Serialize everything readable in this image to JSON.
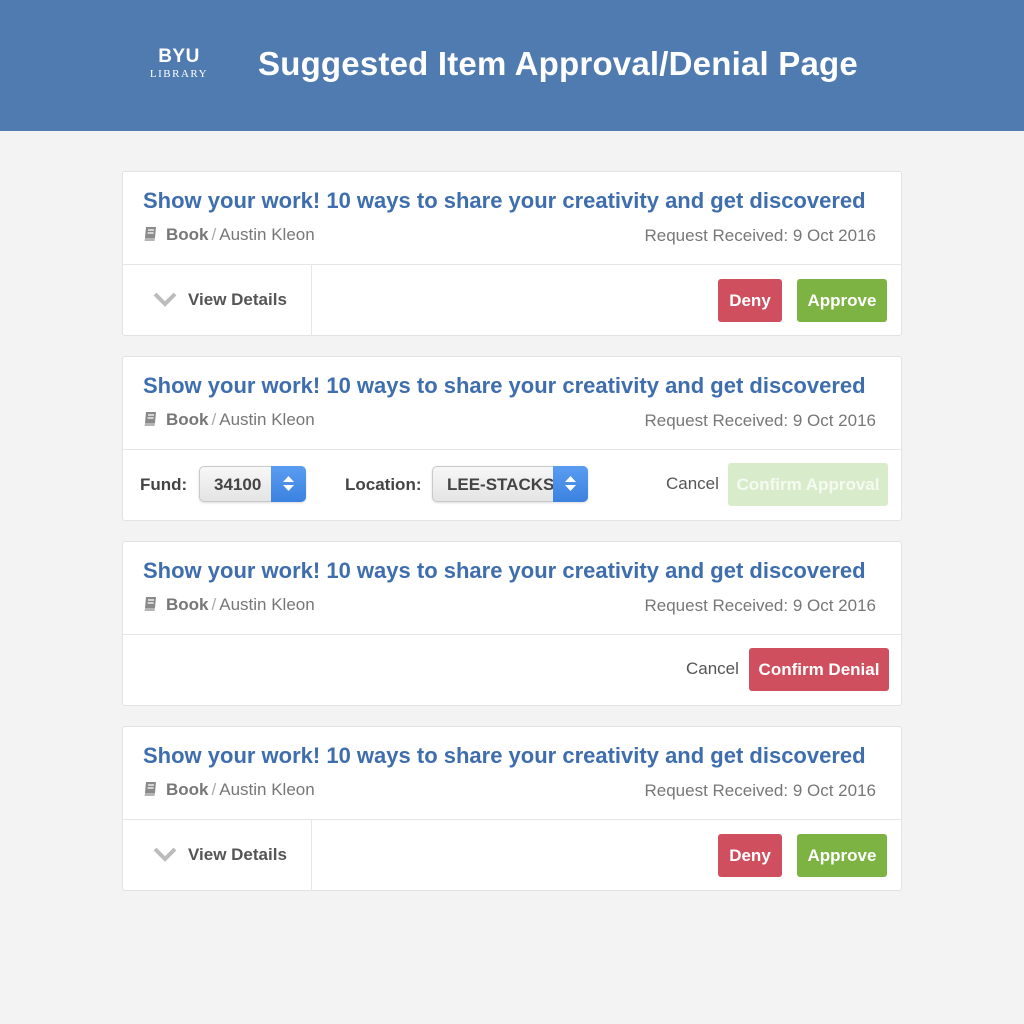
{
  "header": {
    "logo_main": "BYU",
    "logo_sub": "LIBRARY",
    "title": "Suggested Item Approval/Denial Page"
  },
  "cards": [
    {
      "title": "Show your work! 10 ways to share your creativity and get discovered",
      "type": "Book",
      "separator": "/",
      "author": "Austin Kleon",
      "received": "Request Received: 9 Oct 2016",
      "view_details": "View Details",
      "deny": "Deny",
      "approve": "Approve"
    },
    {
      "title": "Show your work! 10 ways to share your creativity and get discovered",
      "type": "Book",
      "separator": "/",
      "author": "Austin Kleon",
      "received": "Request Received: 9 Oct 2016",
      "fund_label": "Fund:",
      "fund_value": "34100",
      "location_label": "Location:",
      "location_value": "LEE-STACKS",
      "cancel": "Cancel",
      "confirm": "Confirm Approval"
    },
    {
      "title": "Show your work! 10 ways to share your creativity and get discovered",
      "type": "Book",
      "separator": "/",
      "author": "Austin Kleon",
      "received": "Request Received: 9 Oct 2016",
      "cancel": "Cancel",
      "confirm": "Confirm Denial"
    },
    {
      "title": "Show your work! 10 ways to share your creativity and get discovered",
      "type": "Book",
      "separator": "/",
      "author": "Austin Kleon",
      "received": "Request Received: 9 Oct 2016",
      "view_details": "View Details",
      "deny": "Deny",
      "approve": "Approve"
    }
  ],
  "icons": {
    "book": "book-icon",
    "chevron": "chevron-down-icon",
    "select_arrows": "select-arrows-icon"
  },
  "colors": {
    "header": "#4f7bb0",
    "title_link": "#3f6eae",
    "deny": "#cf4f5e",
    "approve": "#7cb342",
    "approve_disabled": "#d8ebcb",
    "select_accent": "#3b82e0"
  }
}
